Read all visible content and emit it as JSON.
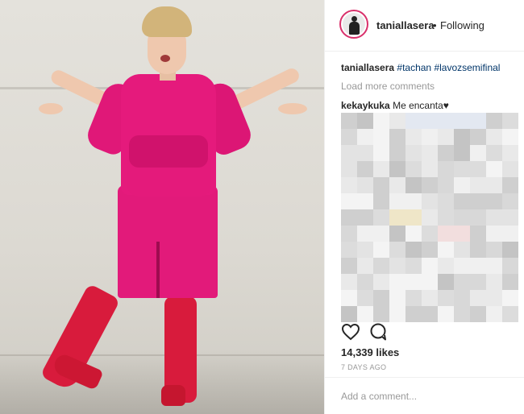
{
  "post": {
    "author": "taniallasera",
    "header_separator": "•",
    "follow_status": "Following",
    "caption": {
      "username": "taniallasera",
      "hashtags": [
        "#tachan",
        "#lavozsemifinal"
      ]
    },
    "load_more_label": "Load more comments",
    "comments": [
      {
        "username": "kekaykuka",
        "text": "Me encanta♥"
      }
    ],
    "likes": "14,339 likes",
    "age": "7 DAYS AGO",
    "comment_placeholder": "Add a comment..."
  },
  "icons": {
    "like": "heart-icon",
    "comment": "speech-bubble-icon"
  },
  "colors": {
    "story_ring": "#d9306b",
    "hashtag": "#003569",
    "muted": "#999999"
  }
}
